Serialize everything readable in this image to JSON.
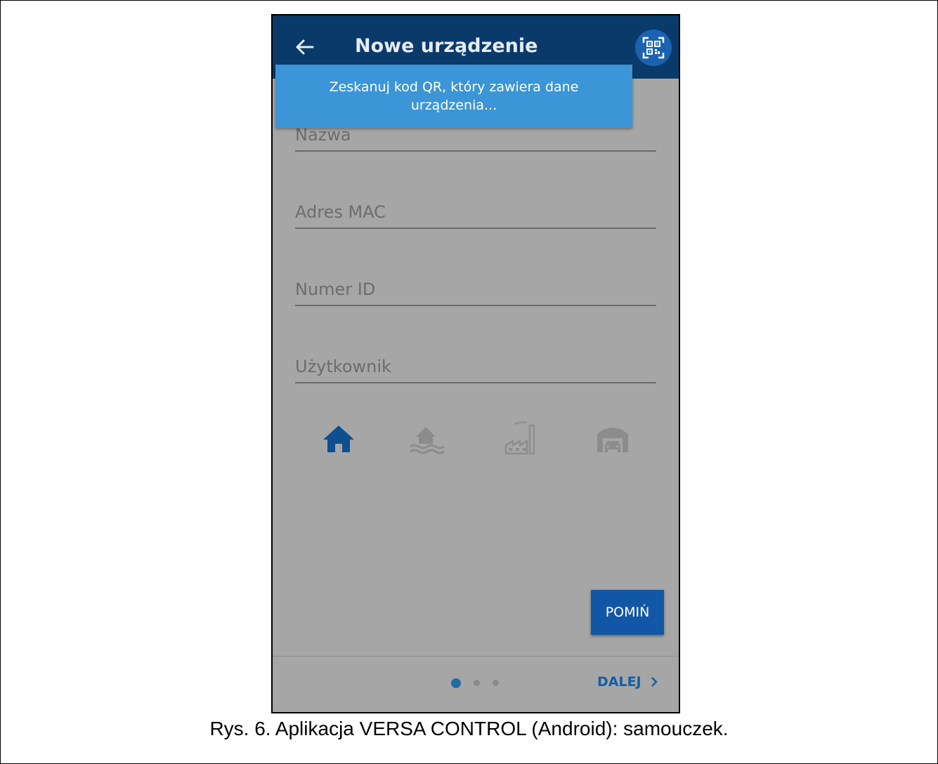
{
  "appbar": {
    "title": "Nowe urządzenie"
  },
  "toast": {
    "message": "Zeskanuj kod QR, który zawiera dane urządzenia..."
  },
  "form": {
    "fields": [
      {
        "label": "Nazwa"
      },
      {
        "label": "Adres MAC"
      },
      {
        "label": "Numer ID"
      },
      {
        "label": "Użytkownik"
      }
    ]
  },
  "object_types": [
    {
      "icon": "house-icon",
      "selected": true
    },
    {
      "icon": "house-by-water-icon",
      "selected": false
    },
    {
      "icon": "factory-icon",
      "selected": false
    },
    {
      "icon": "garage-icon",
      "selected": false
    }
  ],
  "skip_button": {
    "label": "POMIŃ"
  },
  "pager": {
    "current_page": 1,
    "total_pages": 3
  },
  "next_button": {
    "label": "DALEJ"
  },
  "caption": "Rys. 6. Aplikacja VERSA CONTROL (Android): samouczek.",
  "colors": {
    "appbar": "#0a3a6a",
    "toast": "#3b95d6",
    "accent": "#1257a5",
    "overlay_background": "#a6a6a6",
    "selected_icon": "#0d4f8f",
    "unselected_icon": "#8c8c8c"
  }
}
